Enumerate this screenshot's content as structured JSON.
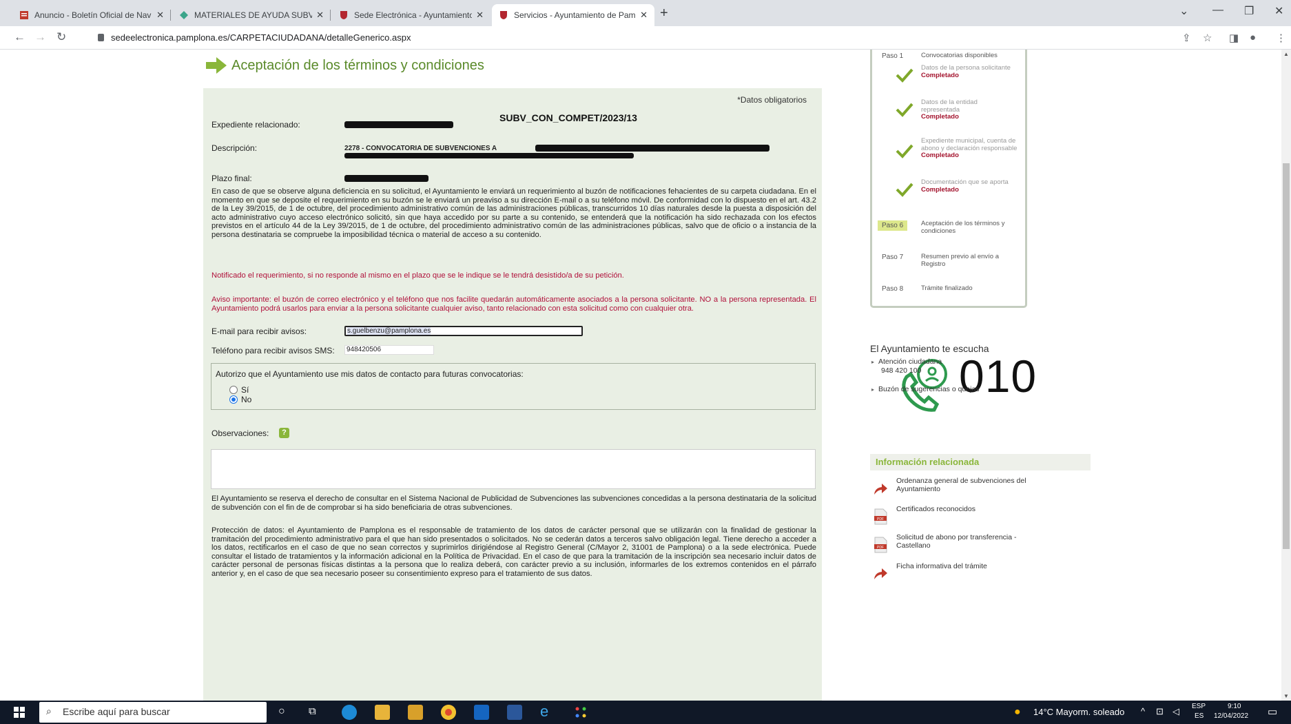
{
  "browser": {
    "tabs": [
      {
        "label": "Anuncio - Boletín Oficial de Nav"
      },
      {
        "label": "MATERIALES DE AYUDA SUBVEN"
      },
      {
        "label": "Sede Electrónica - Ayuntamiento"
      },
      {
        "label": "Servicios - Ayuntamiento de Pam"
      }
    ],
    "url": "sedeelectronica.pamplona.es/CARPETACIUDADANA/detalleGenerico.aspx"
  },
  "page": {
    "section_title": "Aceptación de los términos y condiciones",
    "required_note": "*Datos obligatorios",
    "fields": {
      "expediente_label": "Expediente relacionado:",
      "expediente_value": "SUBV_CON_COMPET/2023/13",
      "descripcion_label": "Descripción:",
      "descripcion_value": "2278 - CONVOCATORIA DE SUBVENCIONES A",
      "plazo_label": "Plazo final:"
    },
    "paragraph_main": "En caso de que se observe alguna deficiencia en su solicitud, el Ayuntamiento le enviará un requerimiento al buzón de notificaciones fehacientes de su carpeta ciudadana. En el momento en que se deposite el requerimiento en su buzón se le enviará un preaviso a su dirección E-mail o a su teléfono móvil. De conformidad con lo dispuesto en el art. 43.2 de la Ley 39/2015, de 1 de octubre, del procedimiento administrativo común de las administraciones públicas, transcurridos 10 días naturales desde la puesta a disposición del acto administrativo cuyo acceso electrónico solicitó, sin que haya accedido por su parte a su contenido, se entenderá que la notificación ha sido rechazada con los efectos previstos en el artículo 44 de la Ley 39/2015, de 1 de octubre, del procedimiento administrativo común de las administraciones públicas, salvo que de oficio o a instancia de la persona destinataria se compruebe la imposibilidad técnica o material de acceso a su contenido.",
    "paragraph_red1": "Notificado el requerimiento, si no responde al mismo en el plazo que se le indique se le tendrá desistido/a de su petición.",
    "paragraph_red2": "Aviso importante: el buzón de correo electrónico y el teléfono que nos facilite quedarán automáticamente asociados a la persona solicitante. NO a la persona representada. El Ayuntamiento podrá usarlos para enviar a la persona solicitante cualquier aviso, tanto relacionado con esta solicitud como con cualquier otra.",
    "email_label": "E-mail para recibir avisos:",
    "email_value": "s.guelbenzu@pamplona.es",
    "sms_label": "Teléfono para recibir avisos SMS:",
    "sms_value": "948420506",
    "consent_question": "Autorizo que el Ayuntamiento use mis datos de contacto para futuras convocatorias:",
    "consent_yes": "Sí",
    "consent_no": "No",
    "consent_selected": "No",
    "observaciones_label": "Observaciones:",
    "paragraph_bdns": "El Ayuntamiento se reserva el derecho de consultar en el Sistema Nacional de Publicidad de Subvenciones las subvenciones concedidas a la persona destinataria de la solicitud de subvención con el fin de de comprobar si ha sido beneficiaria de otras subvenciones.",
    "paragraph_privacy": "Protección de datos: el Ayuntamiento de Pamplona es el responsable de tratamiento de los datos de carácter personal que se utilizarán con la finalidad de gestionar la tramitación del procedimiento administrativo para el que han sido presentados o solicitados. No se cederán datos a terceros salvo obligación legal. Tiene derecho a acceder a los datos, rectificarlos en el caso de que no sean correctos y suprimirlos dirigiéndose al Registro General (C/Mayor 2, 31001 de Pamplona) o a la sede electrónica. Puede consultar el listado de tratamientos y la información adicional en la Política de Privacidad. En el caso de que para la tramitación de la inscripción sea necesario incluir datos de carácter personal de personas físicas distintas a la persona que lo realiza deberá, con carácter previo a su inclusión, informarles de los extremos contenidos en el párrafo anterior y, en el caso de que sea necesario poseer su consentimiento expreso para el tratamiento de sus datos."
  },
  "steps": [
    {
      "num": "Paso 1",
      "label": "Convocatorias disponibles",
      "status": ""
    },
    {
      "num": "",
      "label": "Datos de la persona solicitante",
      "status": "Completado"
    },
    {
      "num": "",
      "label": "Datos de la entidad representada",
      "status": "Completado"
    },
    {
      "num": "",
      "label": "Expediente municipal, cuenta de abono y declaración responsable",
      "status": "Completado"
    },
    {
      "num": "",
      "label": "Documentación que se aporta",
      "status": "Completado"
    },
    {
      "num": "Paso 6",
      "label": "Aceptación de los términos y condiciones",
      "status": ""
    },
    {
      "num": "Paso 7",
      "label": "Resumen previo al envío a Registro",
      "status": ""
    },
    {
      "num": "Paso 8",
      "label": "Trámite finalizado",
      "status": ""
    }
  ],
  "sidebar": {
    "escucha_title": "El Ayuntamiento te escucha",
    "phone_number": "010",
    "atencion_label": "Atención ciudadana",
    "atencion_phone": "948 420 100",
    "buzon_label": "Buzón de sugerencias o quejas",
    "info_title": "Información relacionada",
    "related": [
      {
        "label": "Ordenanza general de subvenciones del Ayuntamiento",
        "icon": "link-arrow-icon"
      },
      {
        "label": "Certificados reconocidos",
        "icon": "pdf-icon"
      },
      {
        "label": "Solicitud de abono por transferencia - Castellano",
        "icon": "pdf-icon"
      },
      {
        "label": "Ficha informativa del trámite",
        "icon": "link-arrow-icon"
      }
    ]
  },
  "taskbar": {
    "search_placeholder": "Escribe aquí para buscar",
    "weather": "14°C  Mayorm. soleado",
    "lang_top": "ESP",
    "lang_bottom": "ES",
    "time": "9:10",
    "date": "12/04/2022"
  },
  "colors": {
    "accent_green": "#8ab63a",
    "title_green": "#5a8a2a",
    "form_bg": "#e9efe4",
    "warning_red": "#b0103a",
    "taskbar": "#101827"
  }
}
